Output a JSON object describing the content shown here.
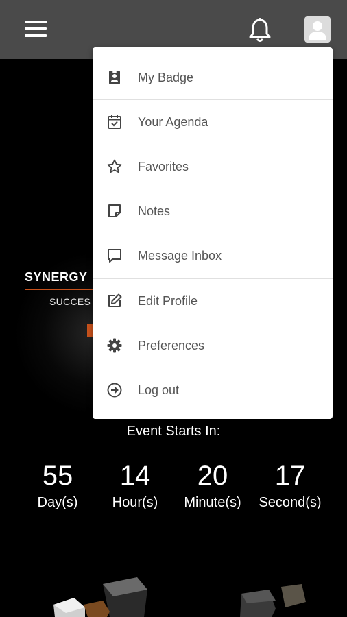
{
  "header": {
    "menu_icon": "hamburger-menu-icon",
    "notification_icon": "bell-icon",
    "profile_icon": "user-avatar-icon"
  },
  "hero": {
    "brand": "SYNERGY",
    "tagline": "SUCCES",
    "accent_color": "#c8521c"
  },
  "countdown": {
    "title": "Event Starts In:",
    "items": [
      {
        "value": "55",
        "unit": "Day(s)"
      },
      {
        "value": "14",
        "unit": "Hour(s)"
      },
      {
        "value": "20",
        "unit": "Minute(s)"
      },
      {
        "value": "17",
        "unit": "Second(s)"
      }
    ]
  },
  "user_menu": {
    "items": [
      {
        "label": "My Badge",
        "icon": "badge-icon"
      },
      {
        "label": "Your Agenda",
        "icon": "calendar-check-icon"
      },
      {
        "label": "Favorites",
        "icon": "star-icon"
      },
      {
        "label": "Notes",
        "icon": "note-icon"
      },
      {
        "label": "Message Inbox",
        "icon": "message-icon"
      },
      {
        "label": "Edit Profile",
        "icon": "edit-icon"
      },
      {
        "label": "Preferences",
        "icon": "gear-icon"
      },
      {
        "label": "Log out",
        "icon": "logout-icon"
      }
    ]
  }
}
